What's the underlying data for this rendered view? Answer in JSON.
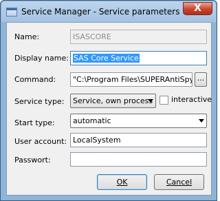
{
  "window": {
    "title": "Service Manager - Service parameters",
    "close_label": "X"
  },
  "form": {
    "name_label": "Name:",
    "name_value": "ISASCORE",
    "display_name_label": "Display name:",
    "display_name_value": "SAS Core Service",
    "command_label": "Command:",
    "command_value": "\"C:\\Program Files\\SUPERAntiSpyw",
    "browse_label": "...",
    "service_type_label": "Service type:",
    "service_type_value": "Service, own process",
    "interactive_label": "interactive",
    "interactive_checked": false,
    "start_type_label": "Start type:",
    "start_type_value": "automatic",
    "user_account_label": "User account:",
    "user_account_value": "LocalSystem",
    "password_label": "Passwort:",
    "password_value": ""
  },
  "buttons": {
    "ok_label": "OK",
    "cancel_label": "Cancel"
  },
  "icons": {
    "app": "window-icon",
    "close": "close-icon",
    "dropdown": "chevron-down-icon"
  }
}
